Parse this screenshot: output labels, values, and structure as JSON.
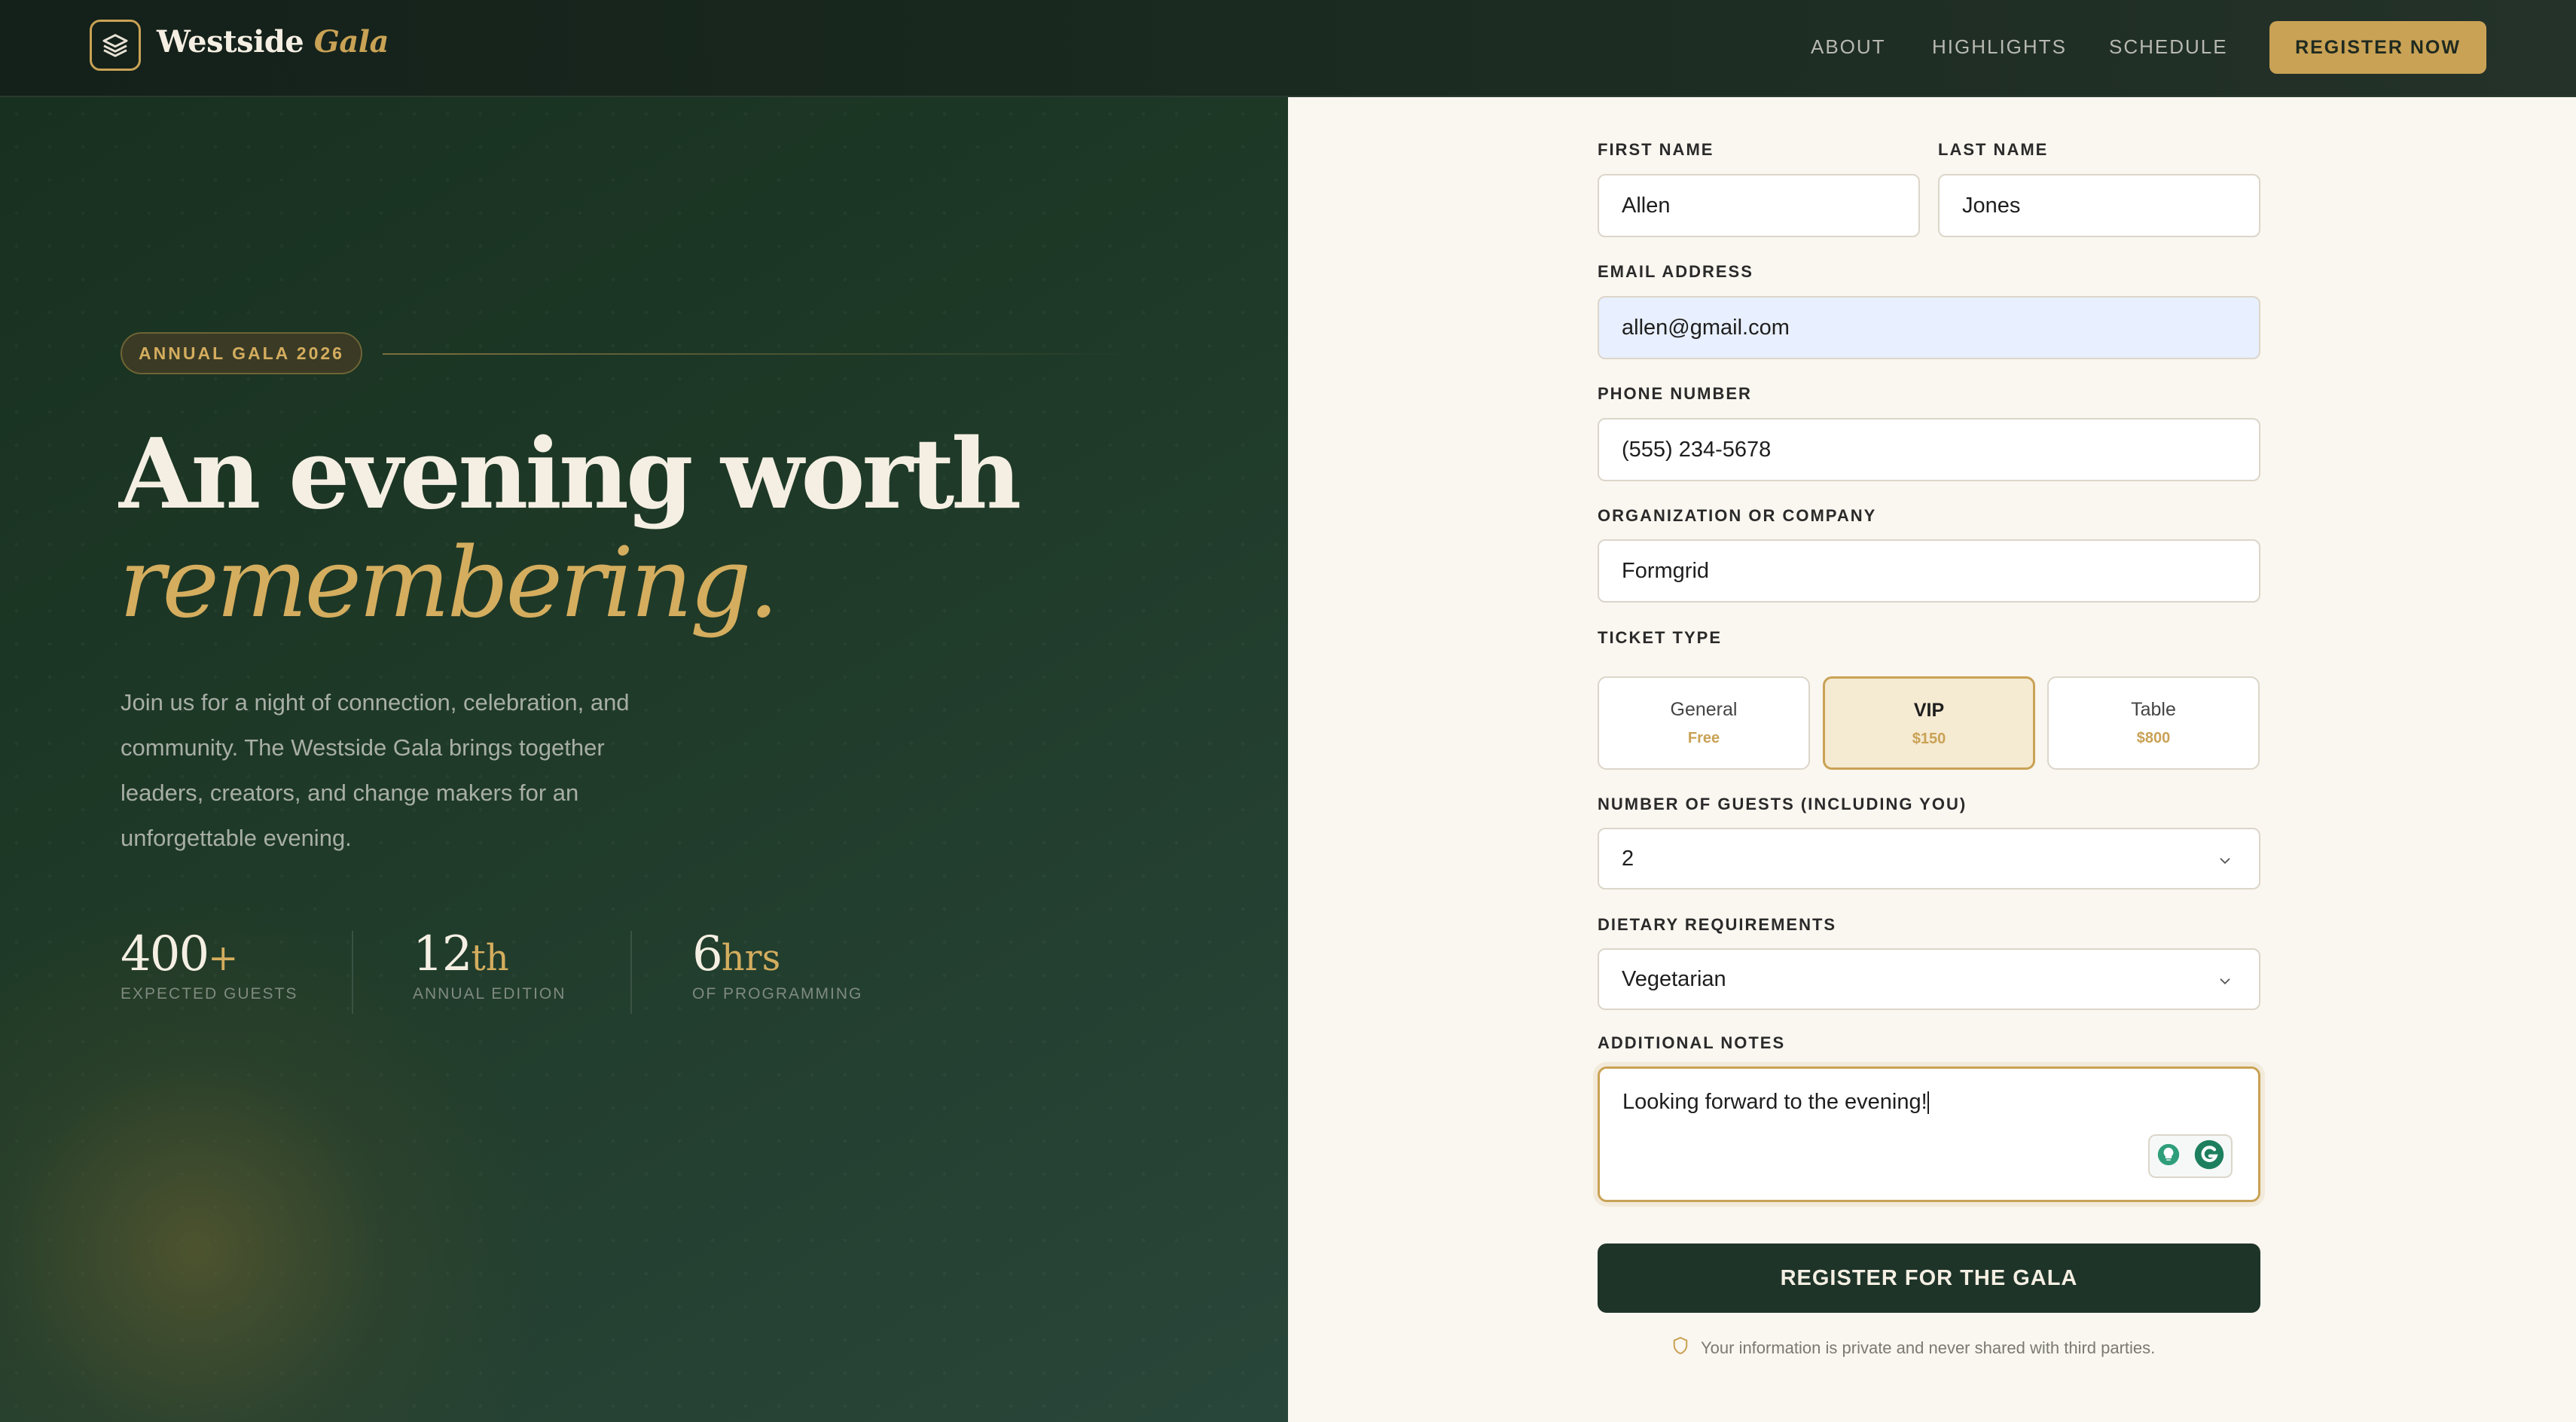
{
  "nav": {
    "brand_main": "Westside",
    "brand_accent": "Gala",
    "links": [
      "ABOUT",
      "HIGHLIGHTS",
      "SCHEDULE"
    ],
    "cta": "REGISTER NOW"
  },
  "hero": {
    "badge": "ANNUAL GALA 2026",
    "headline_line1": "An evening worth",
    "headline_line2": "remembering.",
    "lead": "Join us for a night of connection, celebration, and community. The Westside Gala brings together leaders, creators, and change makers for an unforgettable evening.",
    "stats": [
      {
        "value": "400",
        "suffix": "+",
        "label": "EXPECTED GUESTS"
      },
      {
        "value": "12",
        "suffix": "th",
        "label": "ANNUAL EDITION"
      },
      {
        "value": "6",
        "suffix": "hrs",
        "label": "OF PROGRAMMING"
      }
    ]
  },
  "form": {
    "first_name": {
      "label": "FIRST NAME",
      "value": "Allen"
    },
    "last_name": {
      "label": "LAST NAME",
      "value": "Jones"
    },
    "email": {
      "label": "EMAIL ADDRESS",
      "value": "allen@gmail.com"
    },
    "phone": {
      "label": "PHONE NUMBER",
      "value": "(555) 234-5678"
    },
    "organization": {
      "label": "ORGANIZATION OR COMPANY",
      "value": "Formgrid"
    },
    "ticket": {
      "label": "TICKET TYPE",
      "options": [
        {
          "name": "General",
          "price": "Free"
        },
        {
          "name": "VIP",
          "price": "$150"
        },
        {
          "name": "Table",
          "price": "$800"
        }
      ],
      "selected": "VIP"
    },
    "guests": {
      "label": "NUMBER OF GUESTS (INCLUDING YOU)",
      "value": "2"
    },
    "dietary": {
      "label": "DIETARY REQUIREMENTS",
      "value": "Vegetarian"
    },
    "notes": {
      "label": "ADDITIONAL NOTES",
      "value": "Looking forward to the evening!"
    },
    "submit": "REGISTER FOR THE GALA",
    "privacy": "Your information is private and never shared with third parties."
  },
  "colors": {
    "gold": "#c9a255",
    "dark_green": "#1f3429",
    "cream": "#faf6f0"
  }
}
